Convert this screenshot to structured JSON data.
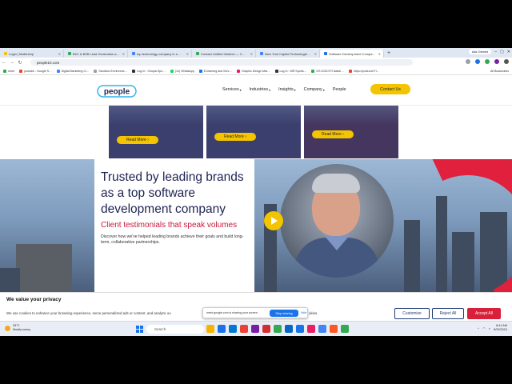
{
  "browser": {
    "tabs": [
      {
        "title": "Login | Mailchimp",
        "color": "#f5c400"
      },
      {
        "title": "B2C & B2B Lead Generation a…",
        "color": "#34a853"
      },
      {
        "title": "top technology company in n…",
        "color": "#4285f4"
      },
      {
        "title": "Contact Unified Infotech — C…",
        "color": "#34a853"
      },
      {
        "title": "New York Capital Technologie…",
        "color": "#4285f4"
      },
      {
        "title": "Software Development Compa…",
        "color": "#1a73e8",
        "active": true
      }
    ],
    "new_tab": "+",
    "gemini_label": "Ask Gemini",
    "url": "people10.com",
    "bookmarks": [
      {
        "label": "meet",
        "color": "#34a853"
      },
      {
        "label": "youtube - Google S…",
        "color": "#ea4335"
      },
      {
        "label": "Digital Marketing Cl…",
        "color": "#4285f4"
      },
      {
        "label": "Sandbox Environme…",
        "color": "#9aa0a6"
      },
      {
        "label": "Log In ‹ Chopai.Spo…",
        "color": "#333333"
      },
      {
        "label": "(14) WhatsApp",
        "color": "#25d366"
      },
      {
        "label": "E-learning and Serv…",
        "color": "#1a73e8"
      },
      {
        "label": "Graphic Design Mat…",
        "color": "#e91e63"
      },
      {
        "label": "Log In ‹ MR Sports…",
        "color": "#333333"
      },
      {
        "label": "GS 2015 ETI Batch…",
        "color": "#34a853"
      },
      {
        "label": "https://youtu.be/Yl…",
        "color": "#ea4335"
      }
    ],
    "all_bookmarks": "All Bookmarks"
  },
  "site": {
    "logo_text": "people",
    "nav": [
      "Services",
      "Industries",
      "Insights",
      "Company",
      "People"
    ],
    "contact_label": "Contact Us",
    "read_more_label": "Read More",
    "hero": {
      "title": "Trusted by leading brands as a top software development company",
      "subtitle": "Client testimonials that speak volumes",
      "body": "Discover how we've helped leading brands achieve their goals and build long-term, collaborative partnerships."
    }
  },
  "cookie": {
    "title": "We value your privacy",
    "text": "We use cookies to enhance your browsing experience, serve personalized ads or content, and analyze ou",
    "text_end": "okies.",
    "customize": "Customize",
    "reject": "Reject All",
    "accept": "Accept All",
    "share_text": "meet.google.com is sharing your screen.",
    "stop_sharing": "Stop sharing",
    "hide": "Hide"
  },
  "taskbar": {
    "weather_temp": "33°C",
    "weather_desc": "Mostly sunny",
    "search_placeholder": "Search",
    "time": "8:41 AM",
    "date": "8/29/2024",
    "apps": [
      "#f4b400",
      "#1a73e8",
      "#0078d4",
      "#ea4335",
      "#7b1fa2",
      "#d32f2f",
      "#34a853",
      "#0a66c2",
      "#1a73e8",
      "#e91e63",
      "#4285f4",
      "#ff5722",
      "#34a853"
    ]
  }
}
